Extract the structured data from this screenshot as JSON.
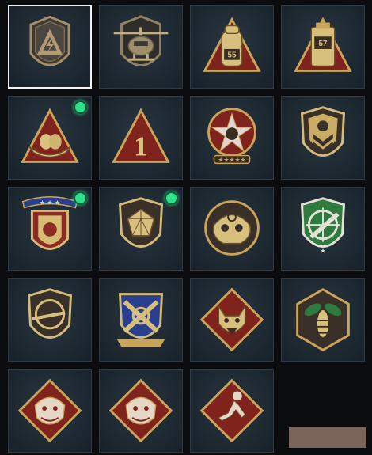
{
  "colors": {
    "gold": "#c9a45a",
    "dark_fill": "#3a302a",
    "red": "#8d2c24",
    "green": "#2e7a3f",
    "new_dot": "#2fe08a"
  },
  "emblems": [
    {
      "icon": "triangle-bolt-shield-icon",
      "selected": true,
      "new": false
    },
    {
      "icon": "helicopter-shield-icon",
      "selected": false,
      "new": false
    },
    {
      "icon": "backpack-55-icon",
      "selected": false,
      "new": false,
      "text": "55"
    },
    {
      "icon": "tag-57-icon",
      "selected": false,
      "new": false,
      "text": "57"
    },
    {
      "icon": "nest-eggs-icon",
      "selected": false,
      "new": true
    },
    {
      "icon": "number-one-triangle-icon",
      "selected": false,
      "new": false,
      "text": "1"
    },
    {
      "icon": "star-skull-badge-icon",
      "selected": false,
      "new": false
    },
    {
      "icon": "chevron-shield-icon",
      "selected": false,
      "new": false
    },
    {
      "icon": "star-ribbon-shield-icon",
      "selected": false,
      "new": true
    },
    {
      "icon": "gem-shield-icon",
      "selected": false,
      "new": true
    },
    {
      "icon": "ghost-mask-icon",
      "selected": false,
      "new": false
    },
    {
      "icon": "green-rifle-crosshair-icon",
      "selected": false,
      "new": false
    },
    {
      "icon": "rifle-crosshair-shield-icon",
      "selected": false,
      "new": false
    },
    {
      "icon": "crossed-bullets-shield-icon",
      "selected": false,
      "new": false
    },
    {
      "icon": "wolf-diamond-icon",
      "selected": false,
      "new": false
    },
    {
      "icon": "hornet-hexagon-icon",
      "selected": false,
      "new": false
    },
    {
      "icon": "dragon-diamond-icon",
      "selected": false,
      "new": false
    },
    {
      "icon": "dragon-diamond-icon",
      "selected": false,
      "new": false
    },
    {
      "icon": "running-figure-diamond-icon",
      "selected": false,
      "new": false
    }
  ]
}
